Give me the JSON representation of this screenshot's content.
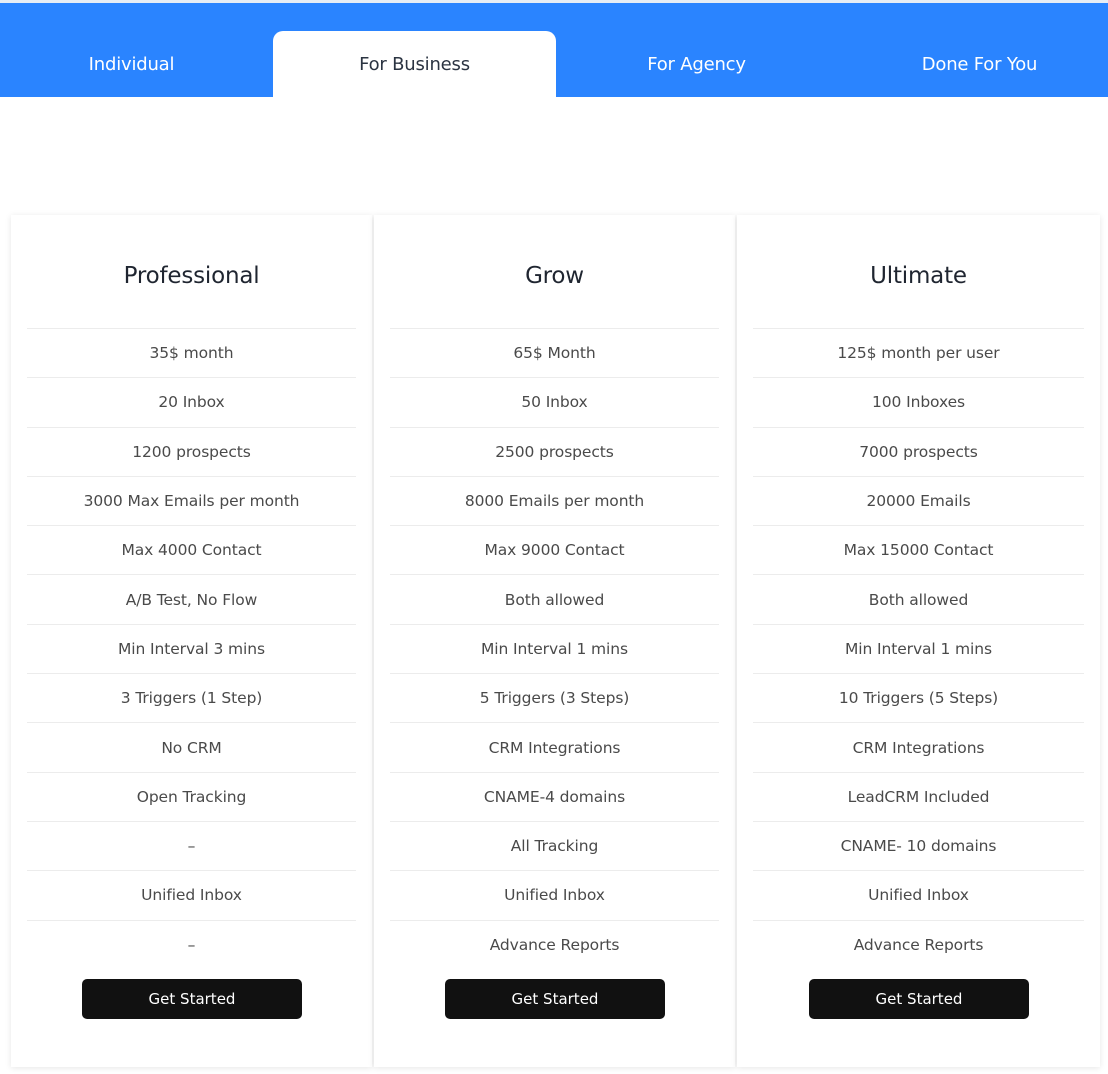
{
  "colors": {
    "accent": "#2a84ff",
    "button": "#111111",
    "active_tab_text": "#2b3442"
  },
  "tabs": [
    {
      "label": "Individual",
      "active": false
    },
    {
      "label": "For Business",
      "active": true
    },
    {
      "label": "For Agency",
      "active": false
    },
    {
      "label": "Done For You",
      "active": false
    }
  ],
  "plans": [
    {
      "title": "Professional",
      "features": [
        "35$ month",
        "20 Inbox",
        "1200 prospects",
        "3000 Max Emails per month",
        "Max 4000 Contact",
        "A/B Test, No Flow",
        "Min Interval 3 mins",
        "3 Triggers (1 Step)",
        "No CRM",
        "Open Tracking",
        "–",
        "Unified Inbox",
        "–"
      ],
      "button_label": "Get Started"
    },
    {
      "title": "Grow",
      "features": [
        "65$ Month",
        "50 Inbox",
        "2500 prospects",
        "8000 Emails per month",
        "Max 9000 Contact",
        "Both allowed",
        "Min Interval 1 mins",
        "5 Triggers (3 Steps)",
        "CRM Integrations",
        "CNAME-4 domains",
        "All Tracking",
        "Unified Inbox",
        "Advance Reports"
      ],
      "button_label": "Get Started"
    },
    {
      "title": "Ultimate",
      "features": [
        "125$ month per user",
        "100 Inboxes",
        "7000 prospects",
        "20000 Emails",
        "Max 15000 Contact",
        "Both allowed",
        "Min Interval 1 mins",
        "10 Triggers (5 Steps)",
        "CRM Integrations",
        "LeadCRM Included",
        "CNAME- 10 domains",
        "Unified Inbox",
        "Advance Reports"
      ],
      "button_label": "Get Started"
    }
  ]
}
